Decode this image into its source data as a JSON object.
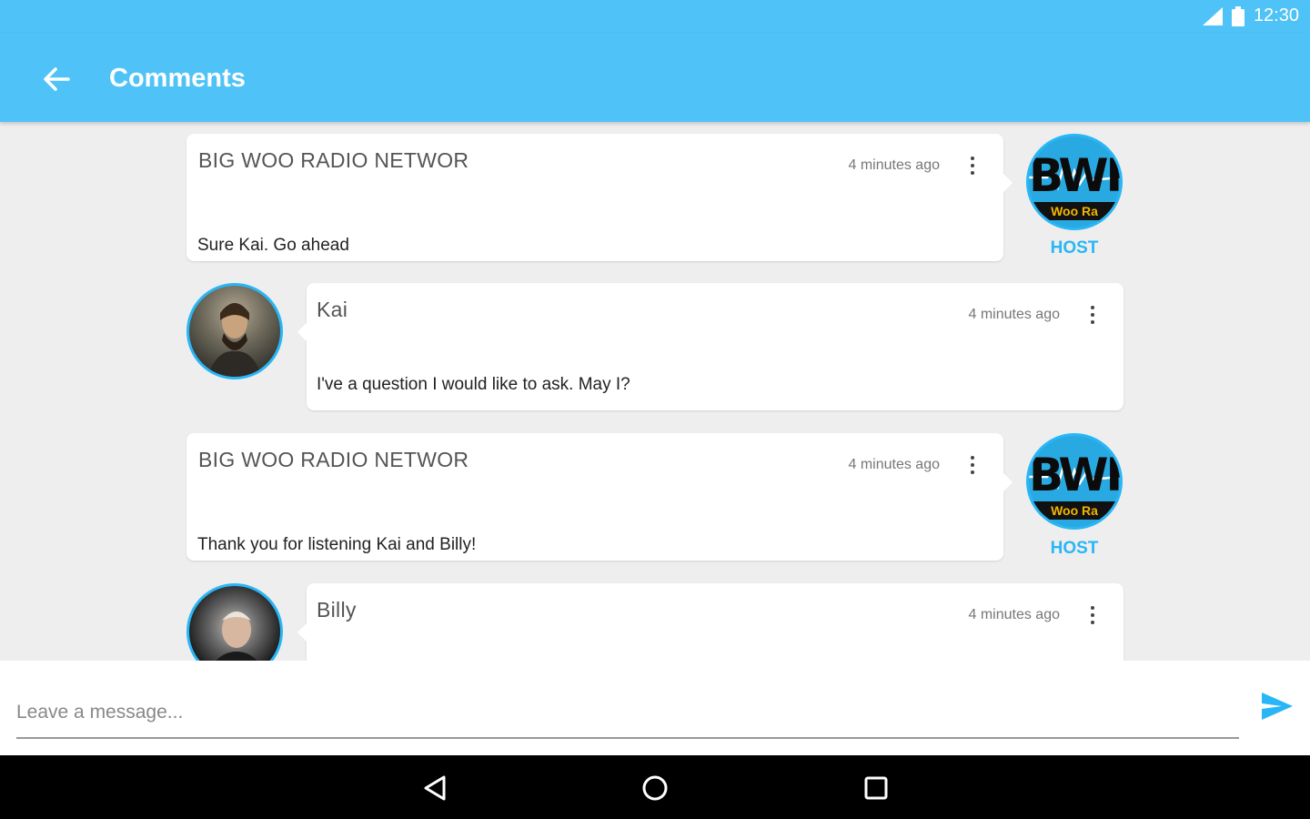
{
  "status_bar": {
    "time": "12:30"
  },
  "app_bar": {
    "title": "Comments"
  },
  "comments": [
    {
      "author": "BIG WOO RADIO NETWOR",
      "time": "4 minutes ago",
      "text": "Sure Kai. Go ahead",
      "role": "host",
      "badge": "HOST",
      "logo_text": "BWR",
      "logo_band": "Woo Ra"
    },
    {
      "author": "Kai",
      "time": "4 minutes ago",
      "text": "I've a question I would like to ask. May I?",
      "role": "user"
    },
    {
      "author": "BIG WOO RADIO NETWOR",
      "time": "4 minutes ago",
      "text": "Thank you for listening Kai and Billy!",
      "role": "host",
      "badge": "HOST",
      "logo_text": "BWR",
      "logo_band": "Woo Ra"
    },
    {
      "author": "Billy",
      "time": "4 minutes ago",
      "text": "",
      "role": "user"
    }
  ],
  "composer": {
    "placeholder": "Leave a message..."
  },
  "colors": {
    "accent": "#4fc3f7",
    "host_label": "#29b6f6"
  },
  "icons": {
    "back": "arrow-back-icon",
    "menu": "more-vert-icon",
    "send": "send-icon",
    "nav": [
      "back-triangle-icon",
      "home-circle-icon",
      "recents-square-icon"
    ]
  }
}
